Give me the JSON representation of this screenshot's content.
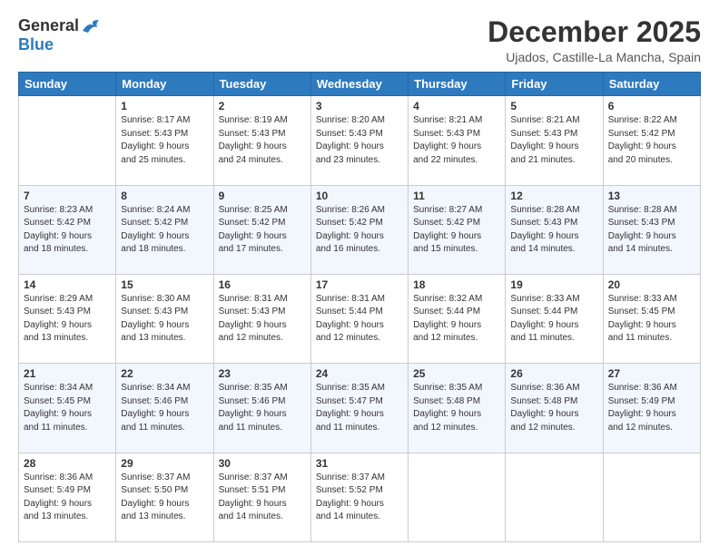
{
  "header": {
    "logo_general": "General",
    "logo_blue": "Blue",
    "title": "December 2025",
    "subtitle": "Ujados, Castille-La Mancha, Spain"
  },
  "columns": [
    "Sunday",
    "Monday",
    "Tuesday",
    "Wednesday",
    "Thursday",
    "Friday",
    "Saturday"
  ],
  "weeks": [
    [
      {
        "day": "",
        "info": ""
      },
      {
        "day": "1",
        "info": "Sunrise: 8:17 AM\nSunset: 5:43 PM\nDaylight: 9 hours\nand 25 minutes."
      },
      {
        "day": "2",
        "info": "Sunrise: 8:19 AM\nSunset: 5:43 PM\nDaylight: 9 hours\nand 24 minutes."
      },
      {
        "day": "3",
        "info": "Sunrise: 8:20 AM\nSunset: 5:43 PM\nDaylight: 9 hours\nand 23 minutes."
      },
      {
        "day": "4",
        "info": "Sunrise: 8:21 AM\nSunset: 5:43 PM\nDaylight: 9 hours\nand 22 minutes."
      },
      {
        "day": "5",
        "info": "Sunrise: 8:21 AM\nSunset: 5:43 PM\nDaylight: 9 hours\nand 21 minutes."
      },
      {
        "day": "6",
        "info": "Sunrise: 8:22 AM\nSunset: 5:42 PM\nDaylight: 9 hours\nand 20 minutes."
      }
    ],
    [
      {
        "day": "7",
        "info": "Sunrise: 8:23 AM\nSunset: 5:42 PM\nDaylight: 9 hours\nand 18 minutes."
      },
      {
        "day": "8",
        "info": "Sunrise: 8:24 AM\nSunset: 5:42 PM\nDaylight: 9 hours\nand 18 minutes."
      },
      {
        "day": "9",
        "info": "Sunrise: 8:25 AM\nSunset: 5:42 PM\nDaylight: 9 hours\nand 17 minutes."
      },
      {
        "day": "10",
        "info": "Sunrise: 8:26 AM\nSunset: 5:42 PM\nDaylight: 9 hours\nand 16 minutes."
      },
      {
        "day": "11",
        "info": "Sunrise: 8:27 AM\nSunset: 5:42 PM\nDaylight: 9 hours\nand 15 minutes."
      },
      {
        "day": "12",
        "info": "Sunrise: 8:28 AM\nSunset: 5:43 PM\nDaylight: 9 hours\nand 14 minutes."
      },
      {
        "day": "13",
        "info": "Sunrise: 8:28 AM\nSunset: 5:43 PM\nDaylight: 9 hours\nand 14 minutes."
      }
    ],
    [
      {
        "day": "14",
        "info": "Sunrise: 8:29 AM\nSunset: 5:43 PM\nDaylight: 9 hours\nand 13 minutes."
      },
      {
        "day": "15",
        "info": "Sunrise: 8:30 AM\nSunset: 5:43 PM\nDaylight: 9 hours\nand 13 minutes."
      },
      {
        "day": "16",
        "info": "Sunrise: 8:31 AM\nSunset: 5:43 PM\nDaylight: 9 hours\nand 12 minutes."
      },
      {
        "day": "17",
        "info": "Sunrise: 8:31 AM\nSunset: 5:44 PM\nDaylight: 9 hours\nand 12 minutes."
      },
      {
        "day": "18",
        "info": "Sunrise: 8:32 AM\nSunset: 5:44 PM\nDaylight: 9 hours\nand 12 minutes."
      },
      {
        "day": "19",
        "info": "Sunrise: 8:33 AM\nSunset: 5:44 PM\nDaylight: 9 hours\nand 11 minutes."
      },
      {
        "day": "20",
        "info": "Sunrise: 8:33 AM\nSunset: 5:45 PM\nDaylight: 9 hours\nand 11 minutes."
      }
    ],
    [
      {
        "day": "21",
        "info": "Sunrise: 8:34 AM\nSunset: 5:45 PM\nDaylight: 9 hours\nand 11 minutes."
      },
      {
        "day": "22",
        "info": "Sunrise: 8:34 AM\nSunset: 5:46 PM\nDaylight: 9 hours\nand 11 minutes."
      },
      {
        "day": "23",
        "info": "Sunrise: 8:35 AM\nSunset: 5:46 PM\nDaylight: 9 hours\nand 11 minutes."
      },
      {
        "day": "24",
        "info": "Sunrise: 8:35 AM\nSunset: 5:47 PM\nDaylight: 9 hours\nand 11 minutes."
      },
      {
        "day": "25",
        "info": "Sunrise: 8:35 AM\nSunset: 5:48 PM\nDaylight: 9 hours\nand 12 minutes."
      },
      {
        "day": "26",
        "info": "Sunrise: 8:36 AM\nSunset: 5:48 PM\nDaylight: 9 hours\nand 12 minutes."
      },
      {
        "day": "27",
        "info": "Sunrise: 8:36 AM\nSunset: 5:49 PM\nDaylight: 9 hours\nand 12 minutes."
      }
    ],
    [
      {
        "day": "28",
        "info": "Sunrise: 8:36 AM\nSunset: 5:49 PM\nDaylight: 9 hours\nand 13 minutes."
      },
      {
        "day": "29",
        "info": "Sunrise: 8:37 AM\nSunset: 5:50 PM\nDaylight: 9 hours\nand 13 minutes."
      },
      {
        "day": "30",
        "info": "Sunrise: 8:37 AM\nSunset: 5:51 PM\nDaylight: 9 hours\nand 14 minutes."
      },
      {
        "day": "31",
        "info": "Sunrise: 8:37 AM\nSunset: 5:52 PM\nDaylight: 9 hours\nand 14 minutes."
      },
      {
        "day": "",
        "info": ""
      },
      {
        "day": "",
        "info": ""
      },
      {
        "day": "",
        "info": ""
      }
    ]
  ]
}
